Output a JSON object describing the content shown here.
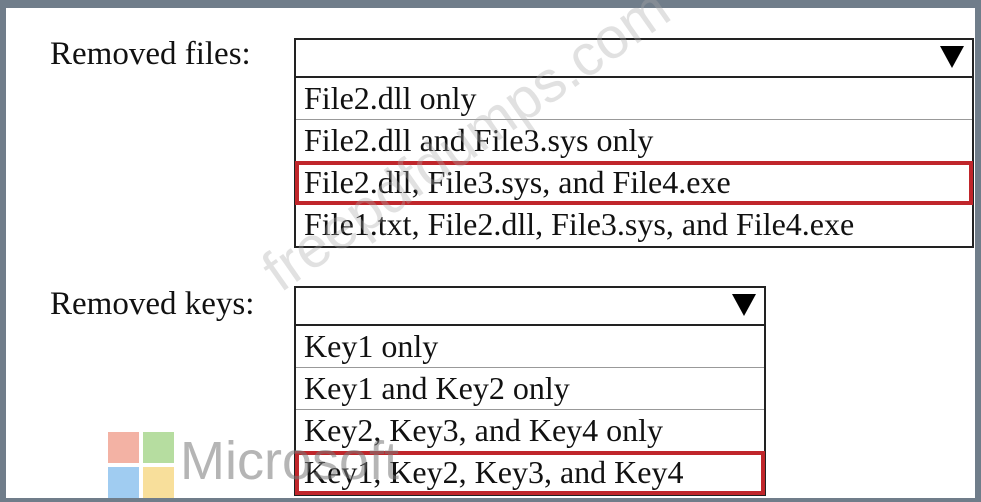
{
  "files": {
    "label": "Removed files:",
    "options": [
      "File2.dll only",
      "File2.dll and File3.sys only",
      "File2.dll, File3.sys, and File4.exe",
      "File1.txt, File2.dll, File3.sys, and File4.exe"
    ],
    "selected_index": 2
  },
  "keys": {
    "label": "Removed keys:",
    "options": [
      "Key1 only",
      "Key1 and Key2 only",
      "Key2, Key3, and Key4 only",
      "Key1, Key2, Key3, and Key4"
    ],
    "selected_index": 3
  },
  "watermark": {
    "text": "freepdfdumps.com"
  },
  "logo": {
    "text": "Microsoft",
    "colors": [
      "#f1a494",
      "#a9d78f",
      "#8fc3ef",
      "#f7d98a"
    ]
  },
  "colors": {
    "frame": "#707d8a",
    "selection": "#c0262b"
  }
}
